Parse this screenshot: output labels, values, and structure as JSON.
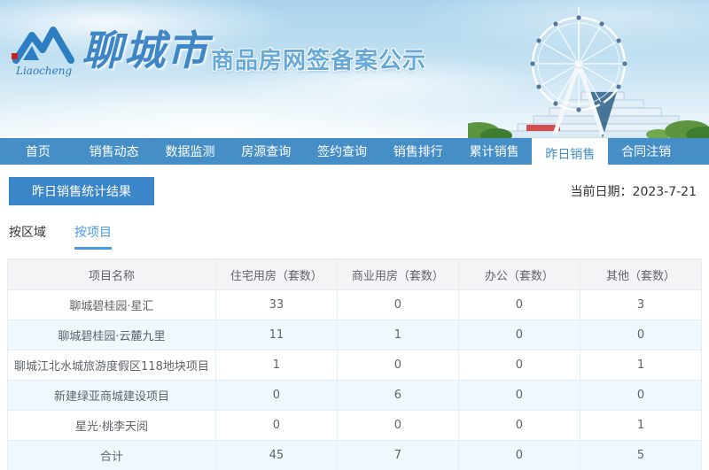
{
  "banner": {
    "logo_script": "Liaocheng",
    "city_name": "聊城市",
    "site_title": "商品房网签备案公示",
    "illustrations": [
      "liaocheng-m-logo",
      "ferris-wheel",
      "stepped-building",
      "trees"
    ]
  },
  "nav": {
    "items": [
      {
        "label": "首页",
        "active": false
      },
      {
        "label": "销售动态",
        "active": false
      },
      {
        "label": "数据监测",
        "active": false
      },
      {
        "label": "房源查询",
        "active": false
      },
      {
        "label": "签约查询",
        "active": false
      },
      {
        "label": "销售排行",
        "active": false
      },
      {
        "label": "累计销售",
        "active": false
      },
      {
        "label": "昨日销售",
        "active": true
      },
      {
        "label": "合同注销",
        "active": false
      }
    ]
  },
  "main": {
    "section_title": "昨日销售统计结果",
    "date_text": "当前日期：2023-7-21",
    "tabs": [
      {
        "label": "按区域",
        "active": false
      },
      {
        "label": "按项目",
        "active": true
      }
    ]
  },
  "table": {
    "headers": [
      "项目名称",
      "住宅用房（套数）",
      "商业用房（套数）",
      "办公（套数）",
      "其他（套数）"
    ],
    "rows": [
      [
        "聊城碧桂园·星汇",
        "33",
        "0",
        "0",
        "3"
      ],
      [
        "聊城碧桂园·云麓九里",
        "11",
        "1",
        "0",
        "0"
      ],
      [
        "聊城江北水城旅游度假区118地块项目",
        "1",
        "0",
        "0",
        "1"
      ],
      [
        "新建绿亚商城建设项目",
        "0",
        "6",
        "0",
        "0"
      ],
      [
        "星光·桃李天阅",
        "0",
        "0",
        "0",
        "1"
      ],
      [
        "合计",
        "45",
        "7",
        "0",
        "5"
      ]
    ]
  },
  "colors": {
    "nav_blue": "#468fc6",
    "active_tab_text": "#3e8cc7",
    "title_box_blue": "#3a86c8",
    "tab_accent": "#4b9ade",
    "table_stripe": "#f0f8fd",
    "table_border": "#e3eef7",
    "header_bg": "#f4f4f6",
    "logo_blue": "#2b7ec2"
  }
}
